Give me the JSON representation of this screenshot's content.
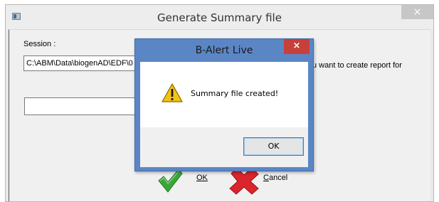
{
  "main_window": {
    "title": "Generate Summary file",
    "close_label": "×",
    "session_label": "Session :",
    "session_value": "C:\\ABM\\Data\\biogenAD\\EDF\\0",
    "right_text": "u want to create report for",
    "second_field_value": "",
    "ok_label": "OK",
    "cancel_label_underlined": "C",
    "cancel_label_rest": "ancel"
  },
  "modal": {
    "title": "B-Alert Live",
    "close_label": "×",
    "message": "Summary file created!",
    "ok_label": "OK"
  },
  "colors": {
    "modal_frame": "#5b86c5",
    "modal_close": "#c7403a",
    "check_green": "#3aa53a",
    "cancel_red": "#d9252b",
    "warning_yellow": "#f2c314"
  },
  "icons": {
    "app_icon": "window-icon",
    "ok_icon": "green-check-icon",
    "cancel_icon": "red-x-icon",
    "modal_icon": "warning-icon"
  }
}
